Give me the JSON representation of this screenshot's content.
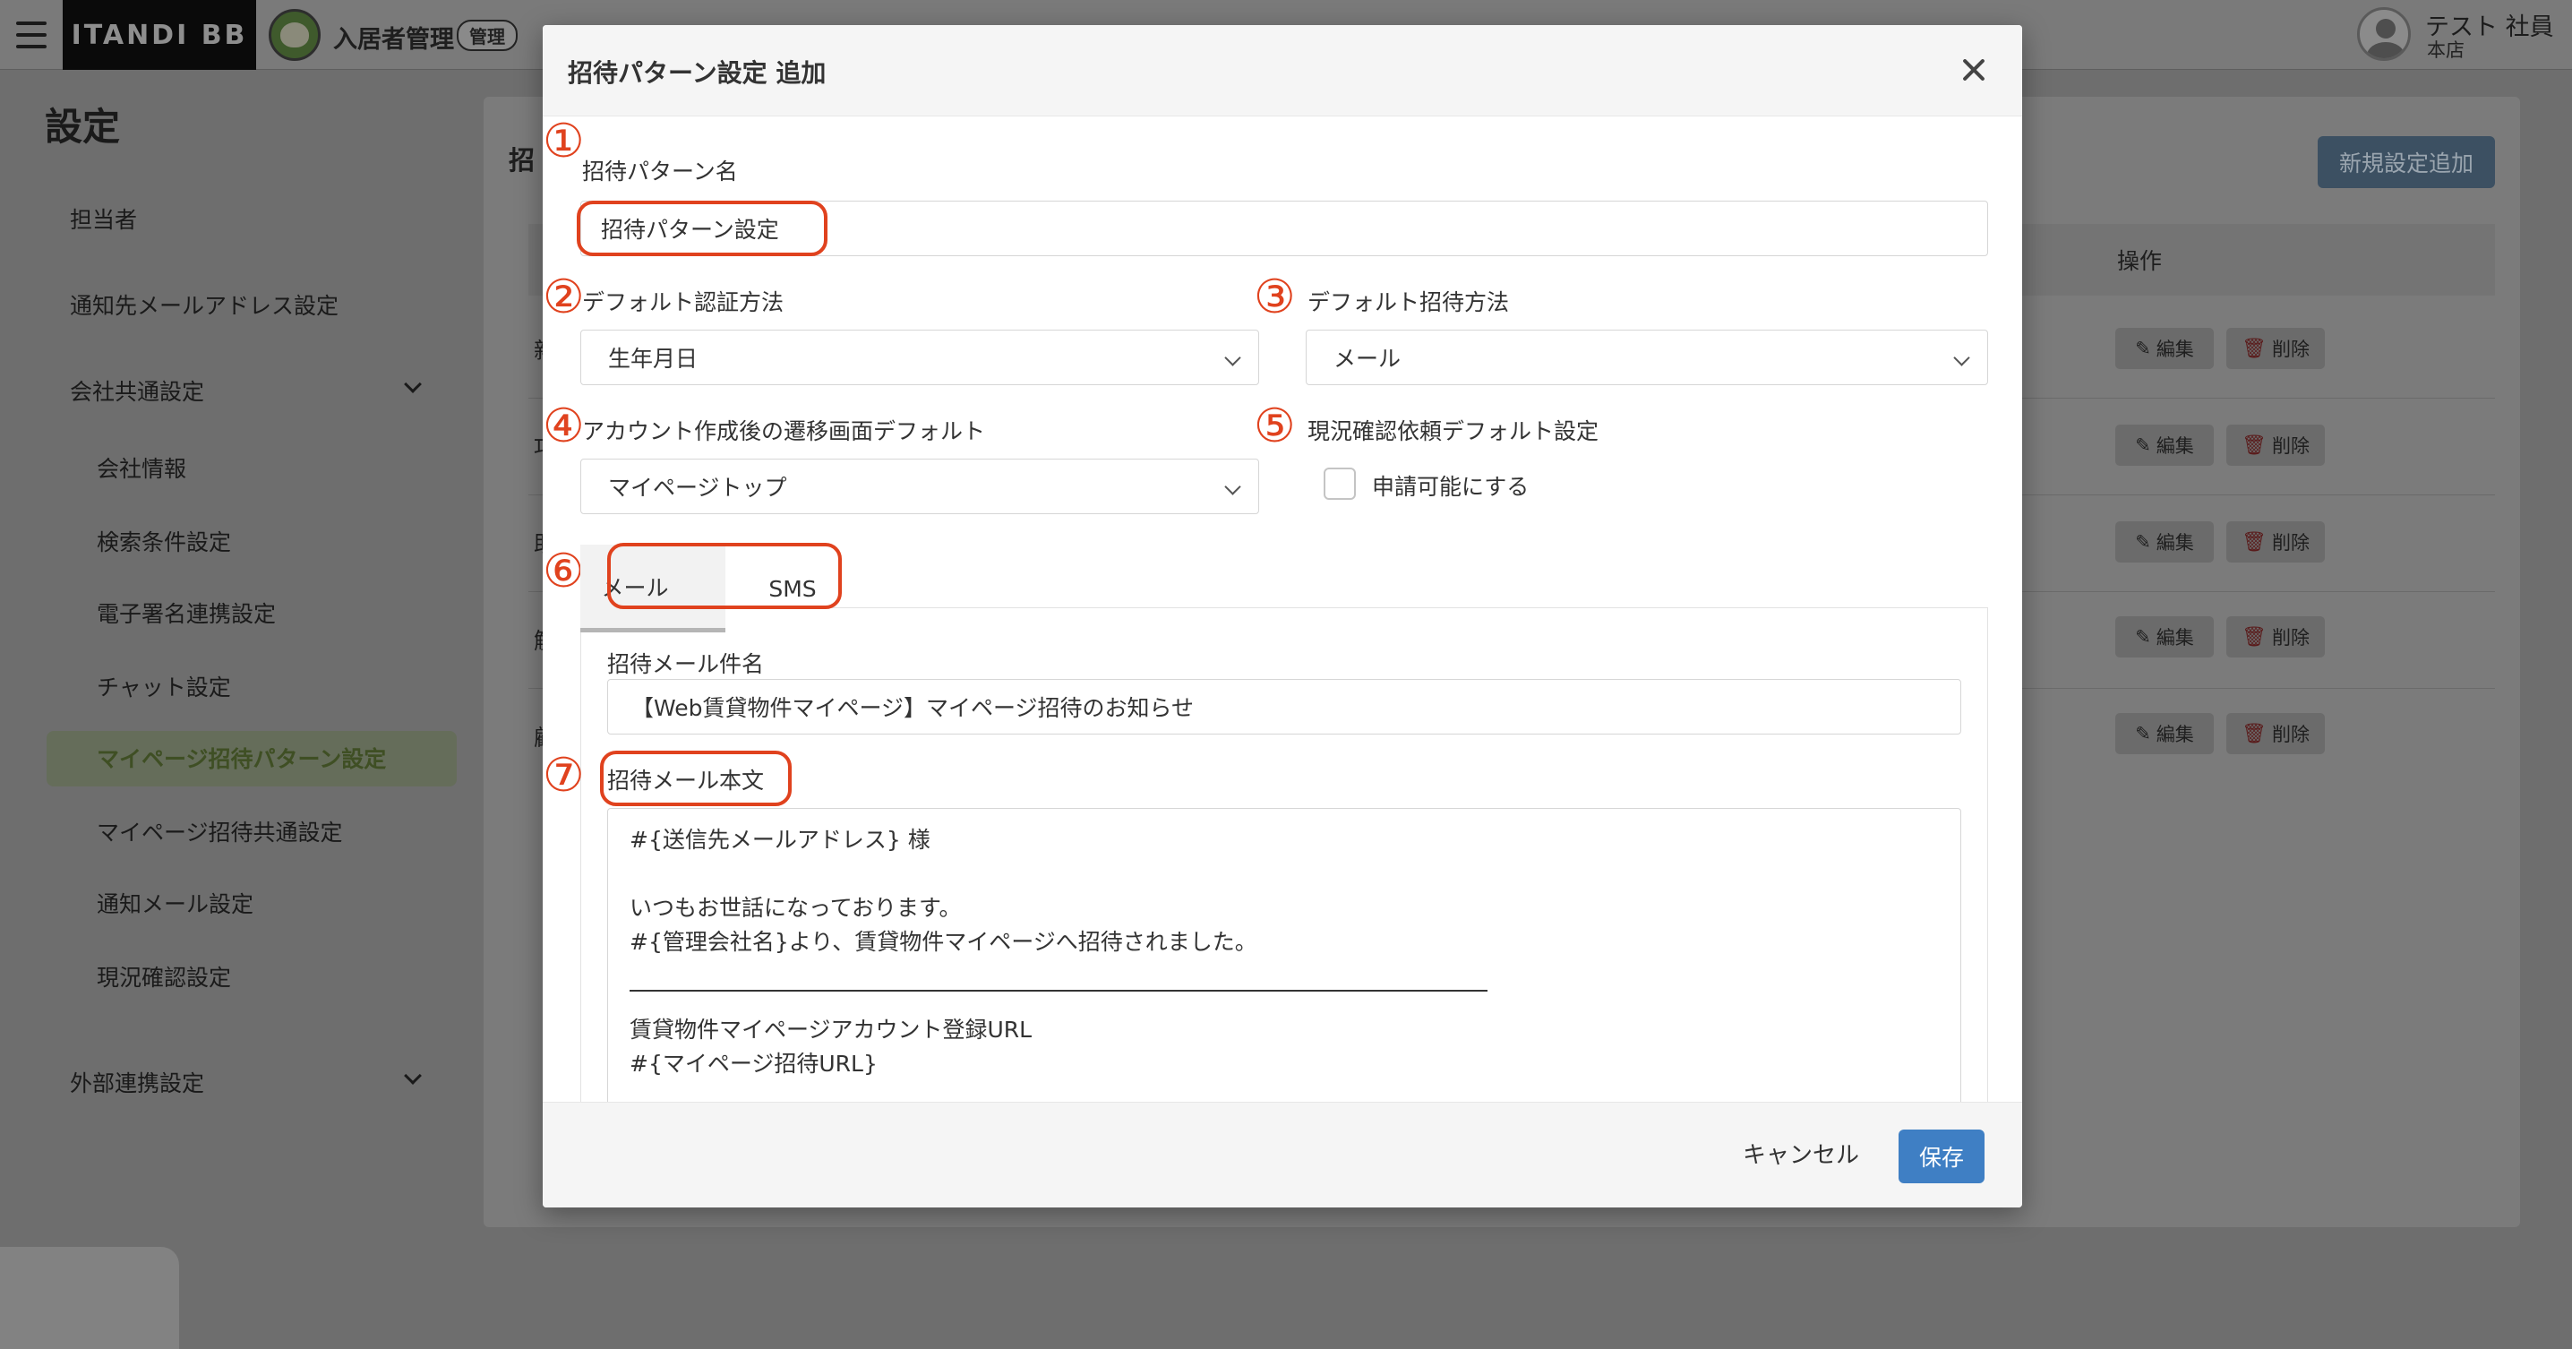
{
  "header": {
    "brand": "ITANDI BB",
    "service_name": "入居者管理",
    "service_badge": "管理",
    "user_name": "テスト 社員",
    "user_store": "本店"
  },
  "sidebar": {
    "title": "設定",
    "items": [
      {
        "label": "担当者"
      },
      {
        "label": "通知先メールアドレス設定"
      },
      {
        "label": "会社共通設定"
      },
      {
        "label": "会社情報"
      },
      {
        "label": "検索条件設定"
      },
      {
        "label": "電子署名連携設定"
      },
      {
        "label": "チャット設定"
      },
      {
        "label": "マイページ招待パターン設定"
      },
      {
        "label": "マイページ招待共通設定"
      },
      {
        "label": "通知メール設定"
      },
      {
        "label": "現況確認設定"
      },
      {
        "label": "外部連携設定"
      }
    ]
  },
  "content": {
    "title_fragment": "招",
    "new_button": "新規設定追加",
    "column_header": "操作",
    "row_fragments": [
      "新",
      "巧",
      "助",
      "解",
      "顧"
    ],
    "edit_label": "編集",
    "delete_label": "削除"
  },
  "modal": {
    "title": "招待パターン設定 追加",
    "markers": [
      "①",
      "②",
      "③",
      "④",
      "⑤",
      "⑥",
      "⑦"
    ],
    "pattern_name_label": "招待パターン名",
    "pattern_name_value": "招待パターン設定",
    "auth_method_label": "デフォルト認証方法",
    "auth_method_value": "生年月日",
    "invite_method_label": "デフォルト招待方法",
    "invite_method_value": "メール",
    "redirect_label": "アカウント作成後の遷移画面デフォルト",
    "redirect_value": "マイページトップ",
    "status_check_label": "現況確認依頼デフォルト設定",
    "status_check_checkbox": "申請可能にする",
    "tabs": [
      "メール",
      "SMS"
    ],
    "subject_label": "招待メール件名",
    "subject_value": "【Web賃貸物件マイページ】マイページ招待のお知らせ",
    "body_label": "招待メール本文",
    "body_lines": [
      "#{送信先メールアドレス} 様",
      "",
      "いつもお世話になっております。",
      "#{管理会社名}より、賃貸物件マイページへ招待されました。",
      "賃貸物件マイページアカウント登録URL",
      "#{マイページ招待URL}"
    ],
    "cancel_label": "キャンセル",
    "save_label": "保存"
  },
  "colors": {
    "accent": "#3f7fc4",
    "annotation": "#e0421e",
    "active_nav": "#3f4f24"
  }
}
